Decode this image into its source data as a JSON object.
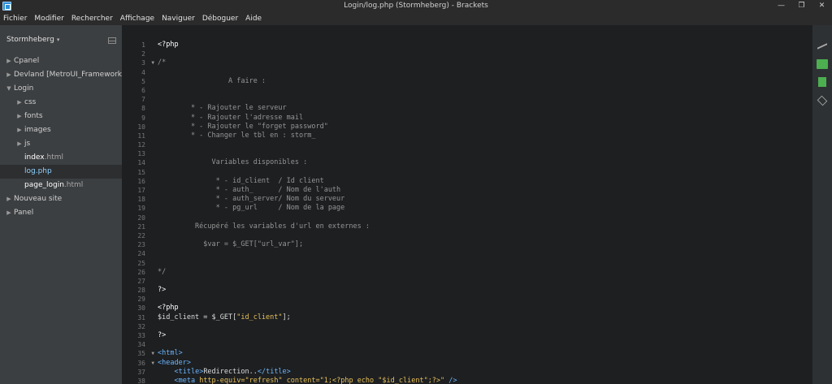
{
  "window": {
    "title": "Login/log.php (Stormheberg) - Brackets",
    "controls": {
      "minimize": "—",
      "maximize": "❐",
      "close": "✕"
    }
  },
  "menu": [
    "Fichier",
    "Modifier",
    "Rechercher",
    "Affichage",
    "Naviguer",
    "Déboguer",
    "Aide"
  ],
  "sidebar": {
    "project": "Stormheberg",
    "project_caret": "▾",
    "tree": [
      {
        "label": "Cpanel",
        "type": "folder",
        "level": 0,
        "arrow": "▶"
      },
      {
        "label": "Devland [MetroUI_Framework]",
        "type": "folder",
        "level": 0,
        "arrow": "▶"
      },
      {
        "label": "Login",
        "type": "folder",
        "level": 0,
        "arrow": "▼"
      },
      {
        "label": "css",
        "type": "folder",
        "level": 1,
        "arrow": "▶"
      },
      {
        "label": "fonts",
        "type": "folder",
        "level": 1,
        "arrow": "▶"
      },
      {
        "label": "images",
        "type": "folder",
        "level": 1,
        "arrow": "▶"
      },
      {
        "label": "js",
        "type": "folder",
        "level": 1,
        "arrow": "▶"
      },
      {
        "label": "index",
        "ext": ".html",
        "type": "file",
        "level": 1
      },
      {
        "label": "log",
        "ext": ".php",
        "type": "file",
        "level": 1,
        "selected": true
      },
      {
        "label": "page_login",
        "ext": ".html",
        "type": "file",
        "level": 1
      },
      {
        "label": "Nouveau site",
        "type": "folder",
        "level": 0,
        "arrow": "▶"
      },
      {
        "label": "Panel",
        "type": "folder",
        "level": 0,
        "arrow": "▶"
      }
    ]
  },
  "editor": {
    "lines": [
      {
        "n": "1",
        "tokens": [
          [
            "c-kw",
            "<?php"
          ]
        ]
      },
      {
        "n": "2",
        "tokens": []
      },
      {
        "n": "3",
        "fold": "▼",
        "tokens": [
          [
            "c-comment",
            "/*"
          ]
        ]
      },
      {
        "n": "4",
        "tokens": []
      },
      {
        "n": "5",
        "tokens": [
          [
            "c-comment",
            "                 A faire :"
          ]
        ]
      },
      {
        "n": "6",
        "tokens": []
      },
      {
        "n": "7",
        "tokens": []
      },
      {
        "n": "8",
        "tokens": [
          [
            "c-comment",
            "        * - Rajouter le serveur"
          ]
        ]
      },
      {
        "n": "9",
        "tokens": [
          [
            "c-comment",
            "        * - Rajouter l'adresse mail"
          ]
        ]
      },
      {
        "n": "10",
        "tokens": [
          [
            "c-comment",
            "        * - Rajouter le \"forget password\""
          ]
        ]
      },
      {
        "n": "11",
        "tokens": [
          [
            "c-comment",
            "        * - Changer le tbl en : storm_"
          ]
        ]
      },
      {
        "n": "12",
        "tokens": []
      },
      {
        "n": "13",
        "tokens": []
      },
      {
        "n": "14",
        "tokens": [
          [
            "c-comment",
            "             Variables disponibles :"
          ]
        ]
      },
      {
        "n": "15",
        "tokens": []
      },
      {
        "n": "16",
        "tokens": [
          [
            "c-comment",
            "              * - id_client  / Id client"
          ]
        ]
      },
      {
        "n": "17",
        "tokens": [
          [
            "c-comment",
            "              * - auth_      / Nom de l'auth"
          ]
        ]
      },
      {
        "n": "18",
        "tokens": [
          [
            "c-comment",
            "              * - auth_server/ Nom du serveur"
          ]
        ]
      },
      {
        "n": "19",
        "tokens": [
          [
            "c-comment",
            "              * - pg_url     / Nom de la page"
          ]
        ]
      },
      {
        "n": "20",
        "tokens": []
      },
      {
        "n": "21",
        "tokens": [
          [
            "c-comment",
            "         Récupéré les variables d'url en externes :"
          ]
        ]
      },
      {
        "n": "22",
        "tokens": []
      },
      {
        "n": "23",
        "tokens": [
          [
            "c-comment",
            "           $var = $_GET[\"url_var\"];"
          ]
        ]
      },
      {
        "n": "24",
        "tokens": []
      },
      {
        "n": "25",
        "tokens": []
      },
      {
        "n": "26",
        "tokens": [
          [
            "c-comment",
            "*/"
          ]
        ]
      },
      {
        "n": "27",
        "tokens": []
      },
      {
        "n": "28",
        "tokens": [
          [
            "c-kw",
            "?>"
          ]
        ]
      },
      {
        "n": "29",
        "tokens": []
      },
      {
        "n": "30",
        "tokens": [
          [
            "c-kw",
            "<?php"
          ]
        ]
      },
      {
        "n": "31",
        "tokens": [
          [
            "c-text",
            "$id_client = $_GET["
          ],
          [
            "c-str",
            "\"id_client\""
          ],
          [
            "c-text",
            "];"
          ]
        ]
      },
      {
        "n": "32",
        "tokens": []
      },
      {
        "n": "33",
        "tokens": [
          [
            "c-kw",
            "?>"
          ]
        ]
      },
      {
        "n": "34",
        "tokens": []
      },
      {
        "n": "35",
        "fold": "▼",
        "tokens": [
          [
            "c-tag",
            "<html>"
          ]
        ]
      },
      {
        "n": "36",
        "fold": "▼",
        "tokens": [
          [
            "c-tag",
            "<header>"
          ]
        ]
      },
      {
        "n": "37",
        "tokens": [
          [
            "c-text",
            "    "
          ],
          [
            "c-tag",
            "<title>"
          ],
          [
            "c-text",
            "Redirection.."
          ],
          [
            "c-tag",
            "</title>"
          ]
        ]
      },
      {
        "n": "38",
        "tokens": [
          [
            "c-text",
            "    "
          ],
          [
            "c-tag",
            "<meta "
          ],
          [
            "c-attr",
            "http-equiv="
          ],
          [
            "c-str",
            "\"refresh\" "
          ],
          [
            "c-attr",
            "content="
          ],
          [
            "c-str",
            "\"1;<?php echo \"$id_client\";?>\" "
          ],
          [
            "c-tag",
            "/>"
          ]
        ]
      }
    ]
  },
  "right_toolbar": [
    {
      "name": "live-preview-icon"
    },
    {
      "name": "extension-manager-icon"
    },
    {
      "name": "extension-icon"
    },
    {
      "name": "layers-icon"
    }
  ]
}
